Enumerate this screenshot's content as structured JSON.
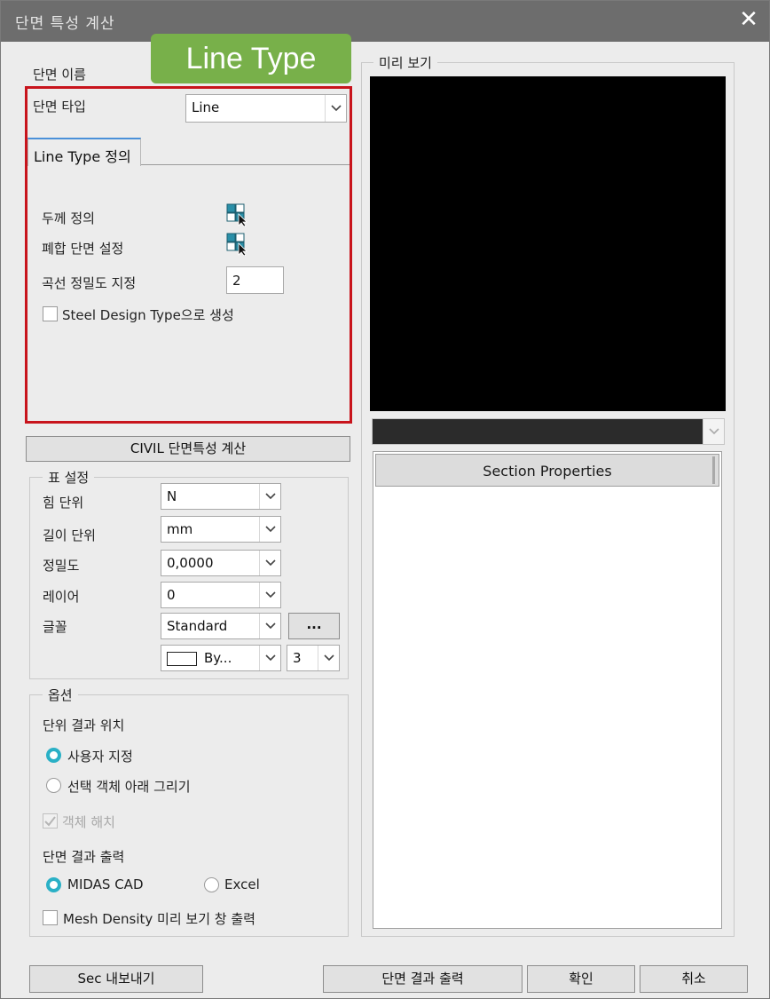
{
  "window": {
    "title": "단면 특성 계산",
    "close_symbol": "✕"
  },
  "badge": {
    "label": "Line Type"
  },
  "section": {
    "name_label": "단면 이름",
    "type_label": "단면 타입",
    "type_value": "Line",
    "tab_label": "Line Type 정의",
    "thickness_label": "두께 정의",
    "composite_label": "폐합 단면 설정",
    "curve_precision_label": "곡선 정밀도 지정",
    "curve_precision_value": "2",
    "steel_design_label": "Steel Design Type으로 생성"
  },
  "civil_button": {
    "label": "CIVIL 단면특성 계산"
  },
  "table_settings": {
    "title": "표 설정",
    "force_unit_label": "힘 단위",
    "force_unit_value": "N",
    "length_unit_label": "길이 단위",
    "length_unit_value": "mm",
    "precision_label": "정밀도",
    "precision_value": "0,0000",
    "layer_label": "레이어",
    "layer_value": "0",
    "font_label": "글꼴",
    "font_value": "Standard",
    "font_more_label": "...",
    "color_value": "By...",
    "size_value": "3"
  },
  "options": {
    "title": "옵션",
    "unit_result_position_label": "단위 결과 위치",
    "user_defined_label": "사용자 지정",
    "draw_below_label": "선택 객체 아래 그리기",
    "unhatch_label": "객체 해치",
    "result_output_label": "단면 결과 출력",
    "midas_cad_label": "MIDAS CAD",
    "excel_label": "Excel",
    "mesh_density_label": "Mesh Density 미리 보기 창 출력"
  },
  "preview": {
    "title": "미리 보기"
  },
  "properties": {
    "header": "Section Properties"
  },
  "footer": {
    "export_label": "Sec 내보내기",
    "output_label": "단면 결과 출력",
    "ok_label": "확인",
    "cancel_label": "취소"
  },
  "icons": {
    "thickness": "pick-icon",
    "composite": "pick-icon",
    "dropdown": "chevron-down-icon",
    "checkmark": "check-icon"
  },
  "colors": {
    "accent_badge": "#78b04a",
    "highlight_border": "#c8141c",
    "radio_on": "#2ab0c6",
    "preview_bg": "#000000"
  }
}
